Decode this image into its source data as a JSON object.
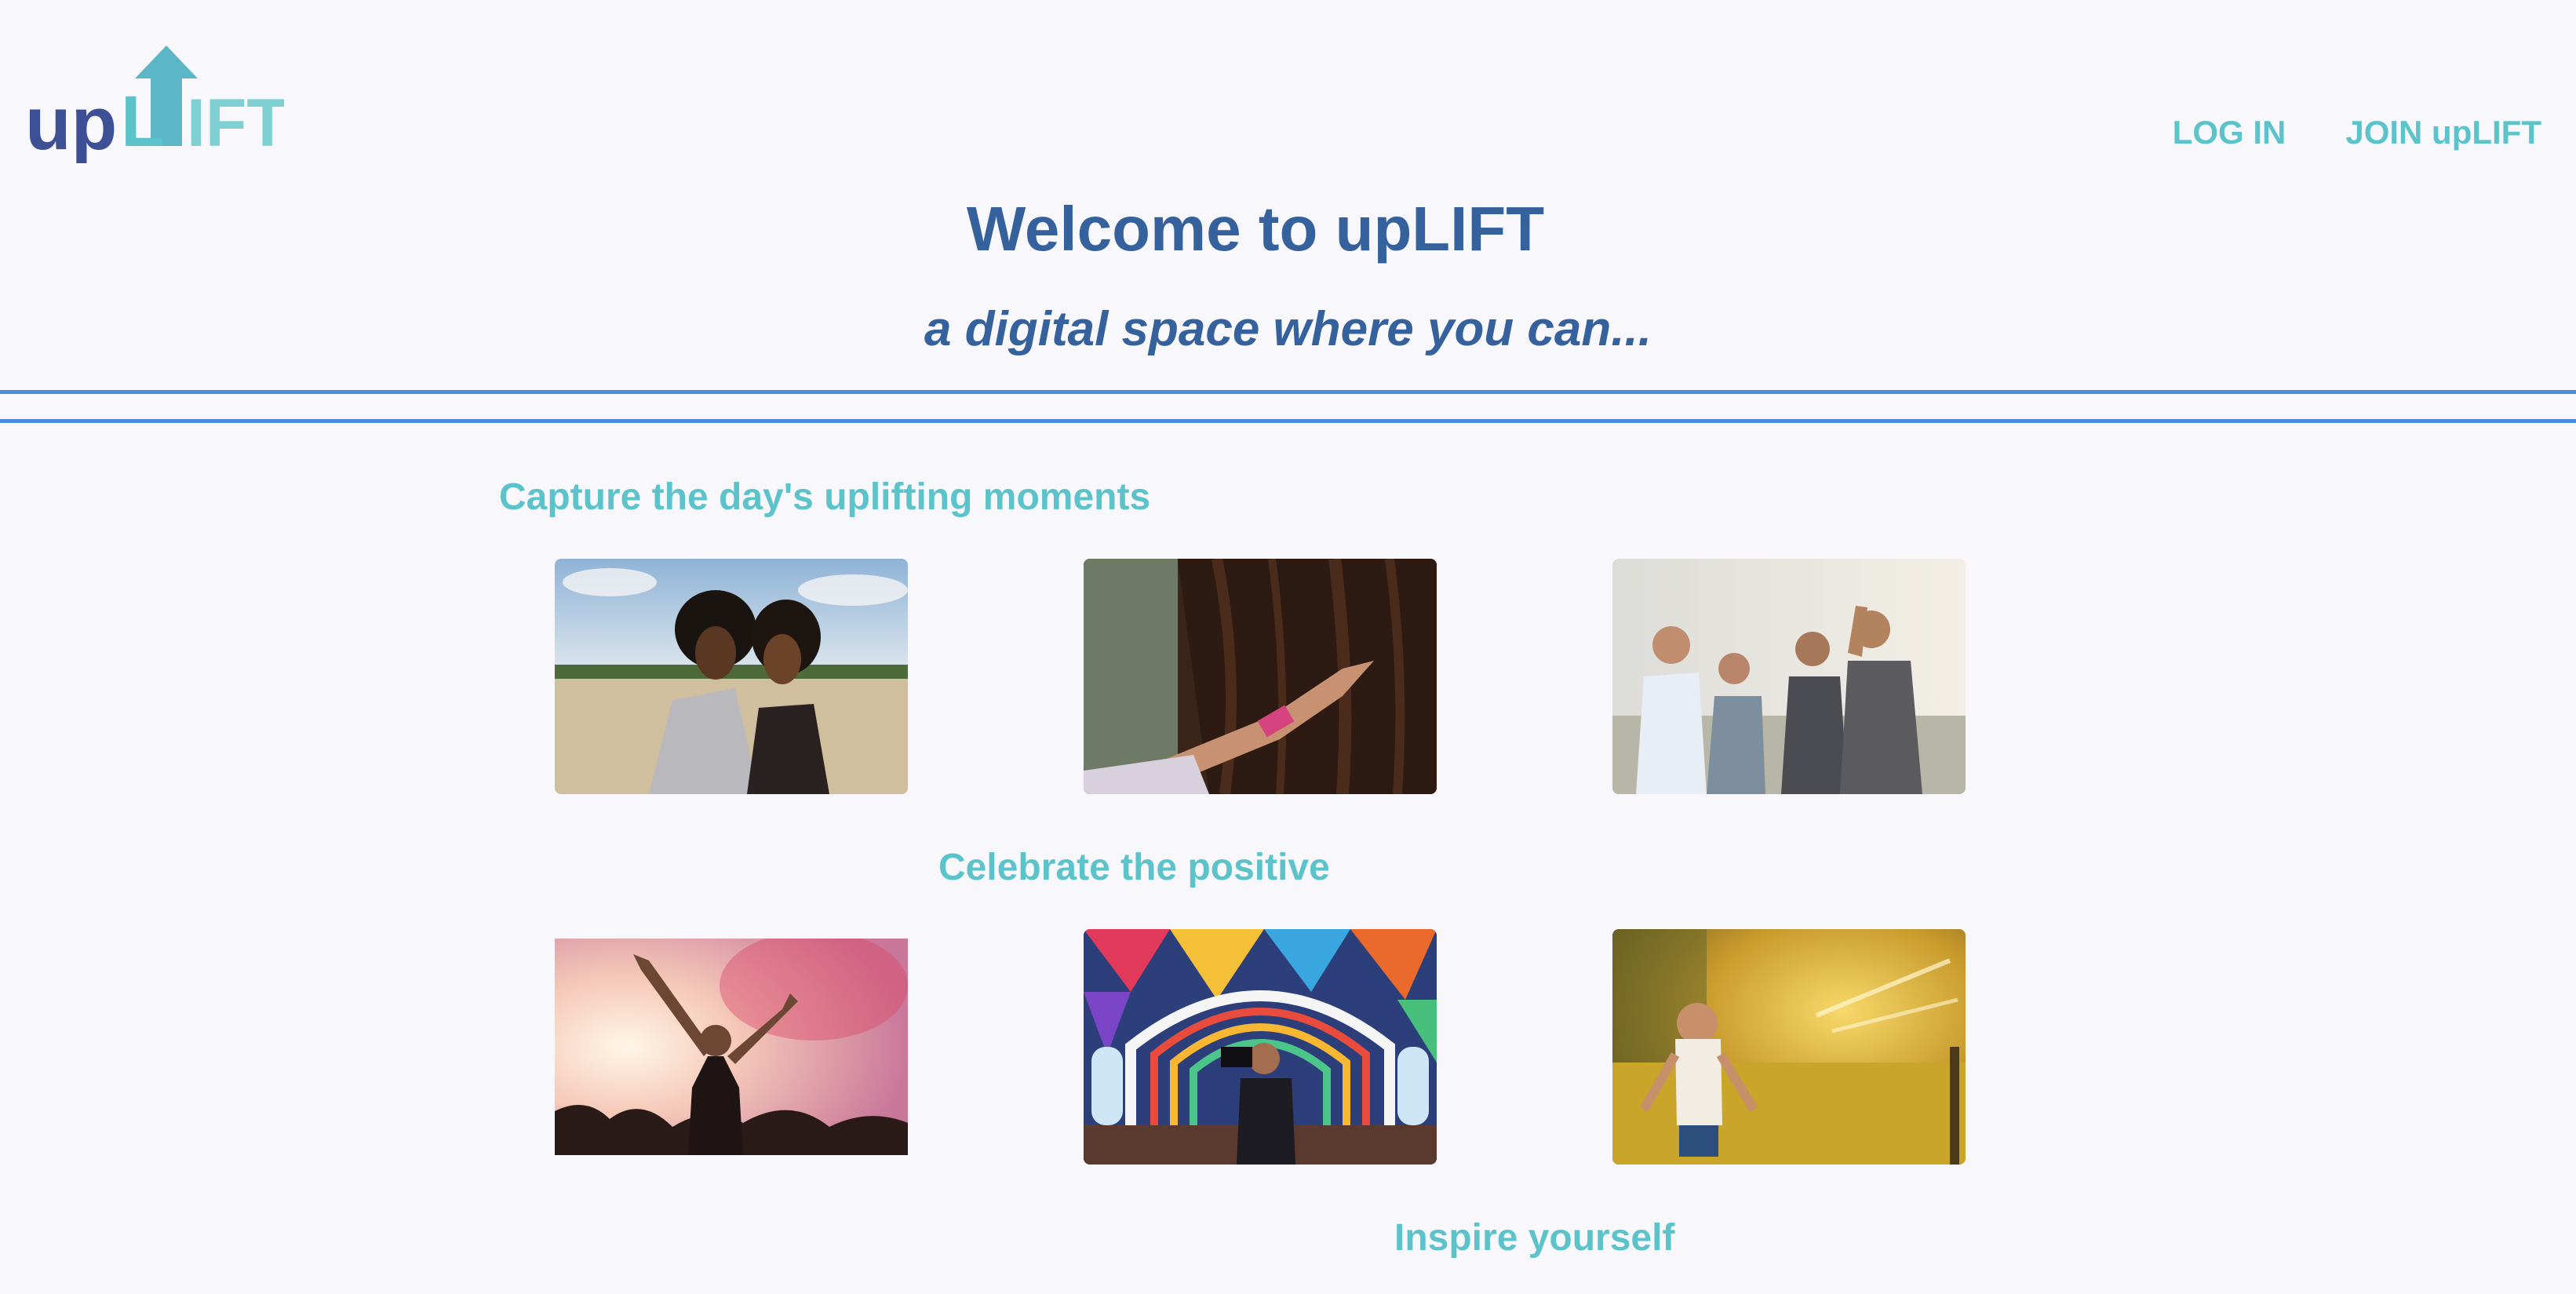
{
  "brand": {
    "logo_text_up": "up",
    "logo_text_lift": "L",
    "logo_text_ift": "IFT",
    "primary_color": "#35619d",
    "accent_color": "#5bc3c9",
    "rule_color": "#4a8de0",
    "background": "#f8f7fc"
  },
  "nav": {
    "login_label": "LOG IN",
    "join_label": "JOIN upLIFT"
  },
  "hero": {
    "title": "Welcome to upLIFT",
    "subtitle": "a digital space where you can..."
  },
  "sections": [
    {
      "title": "Capture the day's uplifting moments",
      "photos": [
        {
          "icon": "two-friends-beach-photo"
        },
        {
          "icon": "hand-tree-photo"
        },
        {
          "icon": "friends-laughing-photo"
        }
      ]
    },
    {
      "title": "Celebrate the positive",
      "photos": [
        {
          "icon": "concert-dancer-photo"
        },
        {
          "icon": "colorful-church-photographer-photo"
        },
        {
          "icon": "child-sprinkler-photo"
        }
      ]
    },
    {
      "title": "Inspire yourself"
    }
  ]
}
